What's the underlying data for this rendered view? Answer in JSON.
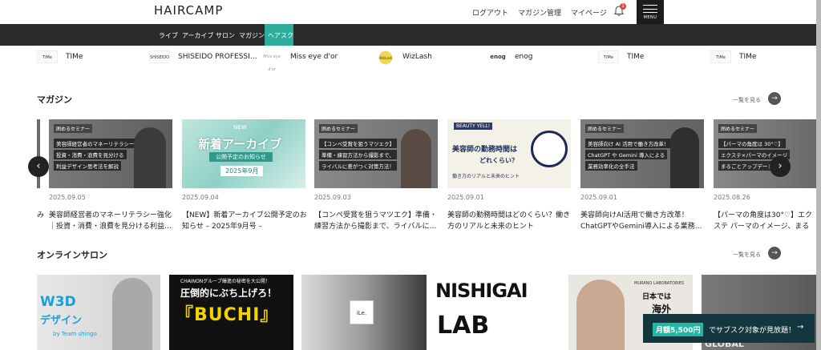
{
  "header": {
    "logo": "HAIRCAMP",
    "logout": "ログアウト",
    "magazine_manage": "マガジン管理",
    "mypage": "マイページ",
    "notif_count": "1",
    "menu": "MENU"
  },
  "nav": {
    "items": [
      "ライブ",
      "アーカイブ",
      "サロン",
      "マガジン",
      "ヘアスク"
    ]
  },
  "brands": [
    {
      "logo": "TIMe",
      "name": "TIMe"
    },
    {
      "logo": "SHISEIDO",
      "name": "SHISEIDO PROFESSI…"
    },
    {
      "logo": "Miss eye d'or",
      "name": "Miss eye d'or"
    },
    {
      "logo": "WizLash",
      "name": "WizLash"
    },
    {
      "logo": "enog",
      "name": "enog"
    },
    {
      "logo": "TIMe",
      "name": "TIMe"
    },
    {
      "logo": "TIMe",
      "name": "TIMe"
    }
  ],
  "magazine": {
    "title": "マガジン",
    "more": "一覧を見る",
    "cards": [
      {
        "date": "",
        "title": "み"
      },
      {
        "date": "2025.09.05",
        "title": "美容師経営者のマネーリテラシー強化｜投資・消費・浪費を見分ける利益…",
        "thumb": {
          "tag": "囲めるセミナー",
          "lines": [
            "美容師経営者のマネーリテラシー強化",
            "投資・消費・浪費を見分ける",
            "利益デザイン思考法を解説"
          ]
        }
      },
      {
        "date": "2025.09.04",
        "title": "【NEW】新着アーカイブ公開予定のお知らせ – 2025年9月号 –",
        "thumb": {
          "badge": "NEW",
          "main": "新着アーカイブ",
          "sub": "公開予定のお知らせ",
          "month": "2025年9月"
        }
      },
      {
        "date": "2025.09.03",
        "title": "【コンペ受賞を狙うマツエク】準備・練習方法から撮影まで、ライバルに…",
        "thumb": {
          "tag": "囲めるセミナー",
          "lines": [
            "【コンペ受賞を狙うマツエク】",
            "準備・練習方法から撮影まで、",
            "ライバルに差がつく対策方法！"
          ]
        }
      },
      {
        "date": "2025.09.01",
        "title": "美容師の勤務時間はどのくらい？働き方のリアルと未来のヒント",
        "thumb": {
          "badge": "BEAUTY YELL!",
          "main": "美容師の勤務時間は",
          "sub": "どれくらい？",
          "foot": "働き方のリアルと未来のヒント"
        }
      },
      {
        "date": "2025.09.01",
        "title": "美容師向けAI活用で働き方改革！ChatGPTやGemini導入による業務…",
        "thumb": {
          "tag": "囲めるセミナー",
          "lines": [
            "美容師向け AI 活用で働き方改革！",
            "ChatGPT や Gemini 導入による",
            "業務効率化の全手法"
          ]
        }
      },
      {
        "date": "2025.08.26",
        "title": "【パーマの角度は30°♡】エクステ パーマのイメージ、まるごとア…",
        "thumb": {
          "tag": "囲めるセミナー",
          "lines": [
            "【パーマの角度は 30°♡】",
            "エクステ×パーマのイメージ",
            "まるごとアップデート"
          ]
        }
      }
    ]
  },
  "salon": {
    "title": "オンラインサロン",
    "more": "一覧を見る",
    "items": [
      {
        "main": "W3D",
        "sub": "デザイン",
        "by": "by Team shingo"
      },
      {
        "top": "CHAINONグループ爆進の秘密を大公開！",
        "main": "圧倒的にぶち上げろ！",
        "big": "『BUCHI』"
      },
      {
        "logo": "iLe."
      },
      {
        "main": "NISHIGAI",
        "sub": "LAB"
      },
      {
        "top": "MURANO LABORATORIES",
        "main": "日本では",
        "sub": "海外"
      },
      {
        "main": "GLOBAL"
      }
    ]
  },
  "cta": {
    "price": "月額5,500円",
    "text": "でサブスク対象が見放題！",
    "arrow": "→"
  },
  "colors": {
    "accent": "#2eae9a",
    "dark": "#2a2a2a",
    "cta_bg": "#14363f"
  }
}
